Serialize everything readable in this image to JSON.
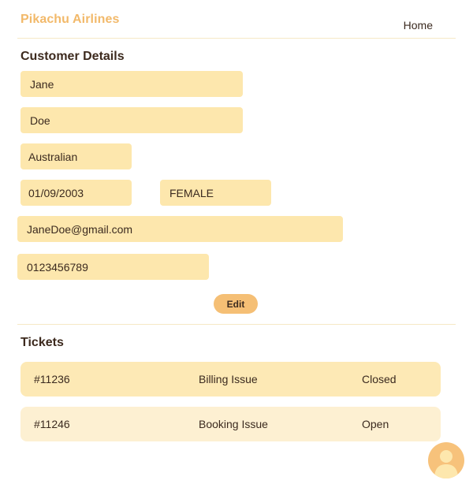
{
  "header": {
    "brand": "Pikachu Airlines",
    "nav": {
      "home": "Home"
    }
  },
  "customer_details": {
    "title": "Customer Details",
    "first_name": "Jane",
    "last_name": "Doe",
    "nationality": "Australian",
    "date_of_birth": "01/09/2003",
    "gender": "FEMALE",
    "email": "JaneDoe@gmail.com",
    "phone": "0123456789",
    "edit_label": "Edit"
  },
  "tickets": {
    "title": "Tickets",
    "items": [
      {
        "id": "#11236",
        "type": "Billing Issue",
        "status": "Closed"
      },
      {
        "id": "#11246",
        "type": "Booking Issue",
        "status": "Open"
      }
    ]
  },
  "colors": {
    "brand": "#f2b96a",
    "field_bg": "#fde7ad",
    "button_bg": "#f5bf75",
    "avatar_bg": "#f7c27b"
  },
  "icons": {
    "avatar": "user-avatar-icon"
  }
}
